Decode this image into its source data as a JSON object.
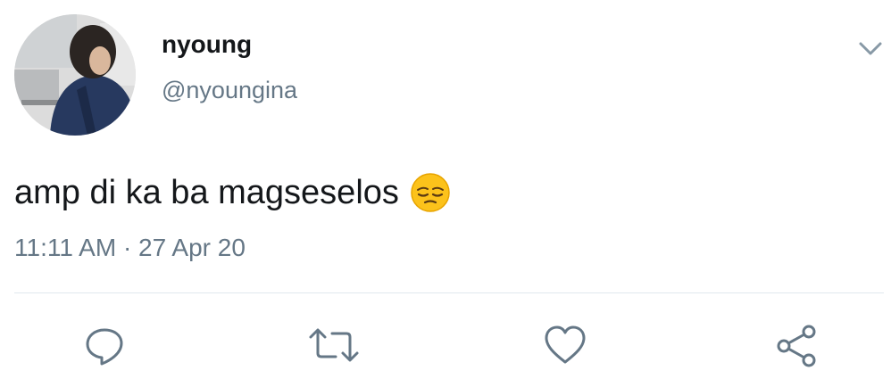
{
  "tweet": {
    "display_name": "nyoung",
    "handle": "@nyoungina",
    "text": "amp di ka ba magseselos",
    "emoji": "pensive-face",
    "time": "11:11 AM",
    "separator": "·",
    "date": "27 Apr 20"
  },
  "icons": {
    "menu": "chevron-down-icon",
    "reply": "reply-icon",
    "retweet": "retweet-icon",
    "like": "heart-icon",
    "share": "share-icon"
  },
  "colors": {
    "text_primary": "#14171a",
    "text_secondary": "#657786",
    "icon": "#657786",
    "divider": "#e1e8ed"
  }
}
